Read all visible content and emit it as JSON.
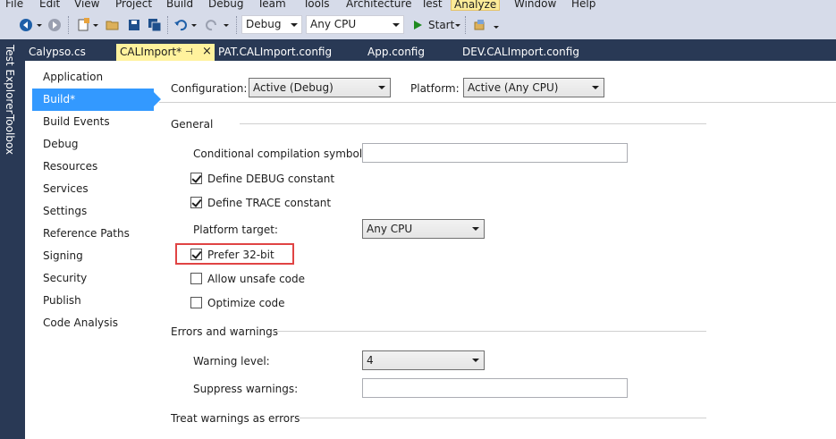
{
  "menu": [
    "File",
    "Edit",
    "View",
    "Project",
    "Build",
    "Debug",
    "Team",
    "Tools",
    "Architecture",
    "Test",
    "Analyze",
    "Window",
    "Help"
  ],
  "active_menu": "Analyze",
  "toolbar": {
    "config_value": "Debug",
    "platform_value": "Any CPU",
    "start_label": "Start"
  },
  "side_tabs": [
    "Test Explorer",
    "Toolbox"
  ],
  "tabs": [
    {
      "label": "Calypso.cs"
    },
    {
      "label": "CALImport*"
    },
    {
      "label": "PAT.CALImport.config"
    },
    {
      "label": "App.config"
    },
    {
      "label": "DEV.CALImport.config"
    }
  ],
  "nav": [
    "Application",
    "Build*",
    "Build Events",
    "Debug",
    "Resources",
    "Services",
    "Settings",
    "Reference Paths",
    "Signing",
    "Security",
    "Publish",
    "Code Analysis"
  ],
  "build": {
    "configuration_label": "Configuration:",
    "configuration_value": "Active (Debug)",
    "platform_label": "Platform:",
    "platform_value": "Active (Any CPU)",
    "general_header": "General",
    "cond_symbols_label": "Conditional compilation symbols:",
    "cond_symbols_value": "",
    "define_debug_label": "Define DEBUG constant",
    "define_debug_checked": true,
    "define_trace_label": "Define TRACE constant",
    "define_trace_checked": true,
    "platform_target_label": "Platform target:",
    "platform_target_value": "Any CPU",
    "prefer32_label": "Prefer 32-bit",
    "prefer32_checked": true,
    "unsafe_label": "Allow unsafe code",
    "unsafe_checked": false,
    "optimize_label": "Optimize code",
    "optimize_checked": false,
    "errors_header": "Errors and warnings",
    "warning_level_label": "Warning level:",
    "warning_level_value": "4",
    "suppress_label": "Suppress warnings:",
    "suppress_value": "",
    "treat_header": "Treat warnings as errors"
  },
  "colors": {
    "accent": "#3399ff",
    "chrome": "#293955",
    "toolbar": "#d6dbe9",
    "active_tab": "#fff29d",
    "highlight": "#e04444"
  }
}
